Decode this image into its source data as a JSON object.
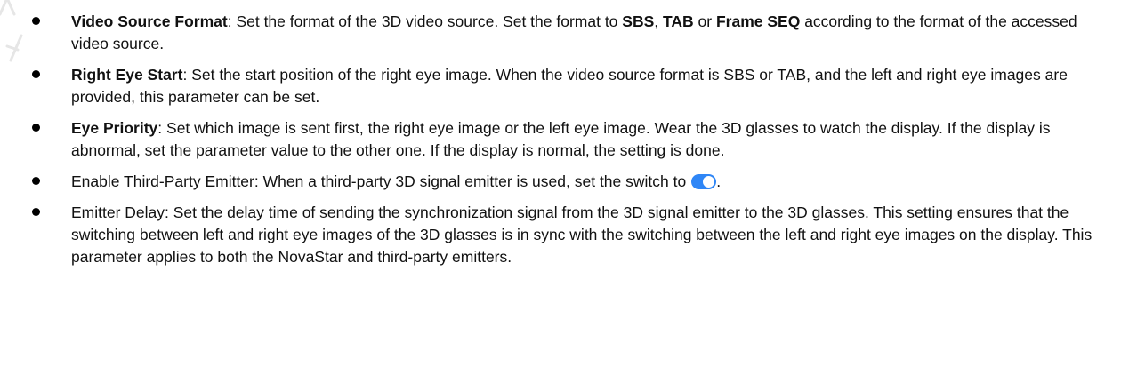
{
  "items": [
    {
      "term": "Video Source Format",
      "sep": ": ",
      "p1": "Set the format of the 3D video source. Set the format to ",
      "opt1": "SBS",
      "c1": ", ",
      "opt2": "TAB",
      "c2": " or ",
      "opt3": "Frame SEQ",
      "p2": " according to the format of the accessed video source."
    },
    {
      "term": "Right Eye Start",
      "sep": ": ",
      "desc": "Set the start position of the right eye image. When the video source format is SBS or TAB, and the left and right eye images are provided, this parameter can be set."
    },
    {
      "term": "Eye Priority",
      "sep": ": ",
      "desc": "Set which image is sent first, the right eye image or the left eye image. Wear the 3D glasses to watch the display. If the display is abnormal, set the parameter value to the other one. If the display is normal, the setting is done."
    },
    {
      "text": "Enable Third-Party Emitter: When a third-party 3D signal emitter is used, set the switch to",
      "end": "."
    },
    {
      "text": "Emitter Delay: Set the delay time of sending the synchronization signal from the 3D signal emitter to the 3D glasses. This setting ensures that the switching between left and right eye images of the 3D glasses is in sync with the switching between the left and right eye images on the display. This parameter applies to both the NovaStar and third-party emitters."
    }
  ],
  "colors": {
    "toggle_on": "#2f86f6",
    "text": "#111111"
  }
}
